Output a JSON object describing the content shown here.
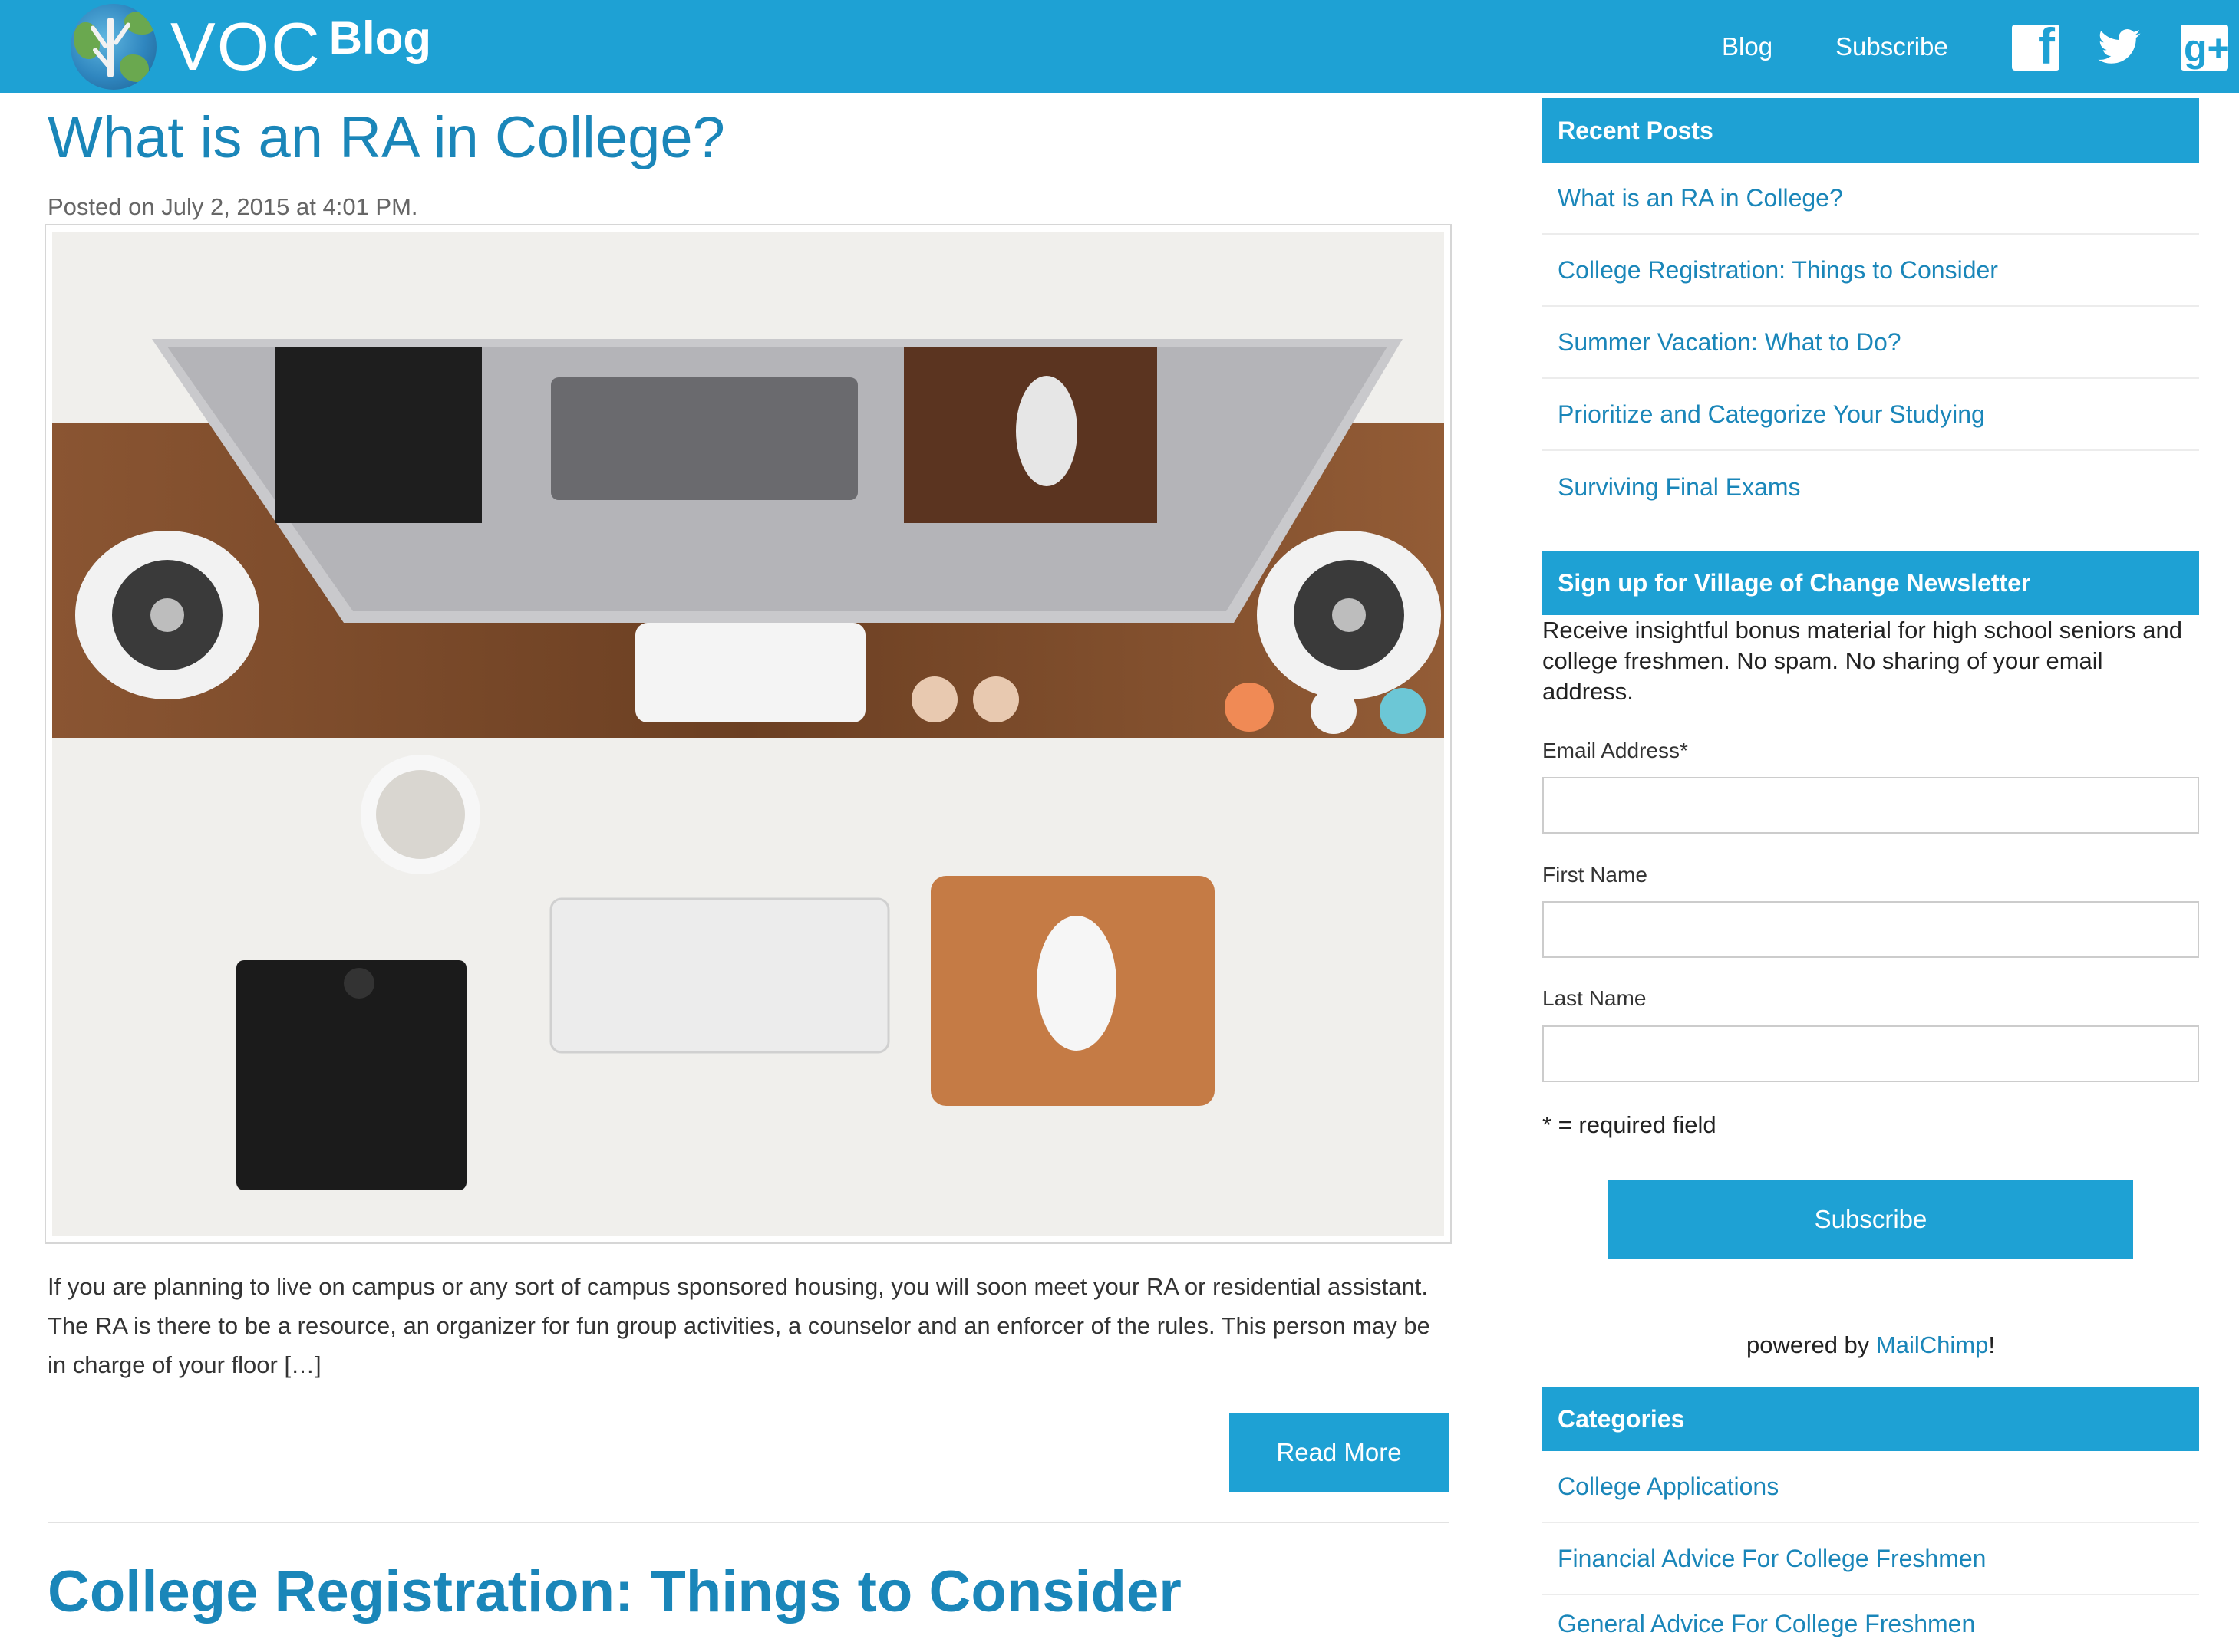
{
  "header": {
    "logo_text": "VOC",
    "logo_suffix": "Blog",
    "nav": [
      {
        "label": "Blog"
      },
      {
        "label": "Subscribe"
      }
    ],
    "social": [
      "facebook-icon",
      "twitter-icon",
      "google-plus-icon"
    ],
    "brand_color": "#1ea1d4"
  },
  "main": {
    "posts": [
      {
        "title": "What is an RA in College?",
        "meta": "Posted on July 2, 2015 at 4:01 PM.",
        "excerpt": "If you are planning to live on campus or any sort of campus sponsored housing, you will soon meet your RA or residential assistant. The RA is there to be a resource, an organizer for fun group activities, a counselor and an enforcer of the rules. This person may be in charge of your floor […]",
        "read_more_label": "Read More"
      },
      {
        "title": "College Registration: Things to Consider"
      }
    ]
  },
  "sidebar": {
    "recent_posts": {
      "heading": "Recent Posts",
      "items": [
        "What is an RA in College?",
        "College Registration: Things to Consider",
        "Summer Vacation: What to Do?",
        "Prioritize and Categorize Your Studying",
        "Surviving Final Exams"
      ]
    },
    "newsletter": {
      "heading": "Sign up for Village of Change Newsletter",
      "description": "Receive insightful bonus material for high school seniors and college freshmen. No spam. No sharing of your email address.",
      "email_label": "Email Address*",
      "email_value": "",
      "first_name_label": "First Name",
      "first_name_value": "",
      "last_name_label": "Last Name",
      "last_name_value": "",
      "required_note": "* = required field",
      "subscribe_label": "Subscribe",
      "powered_prefix": "powered by ",
      "powered_link": "MailChimp",
      "powered_suffix": "!"
    },
    "categories": {
      "heading": "Categories",
      "items": [
        "College Applications",
        "Financial Advice For College Freshmen",
        "General Advice For College Freshmen"
      ]
    }
  }
}
